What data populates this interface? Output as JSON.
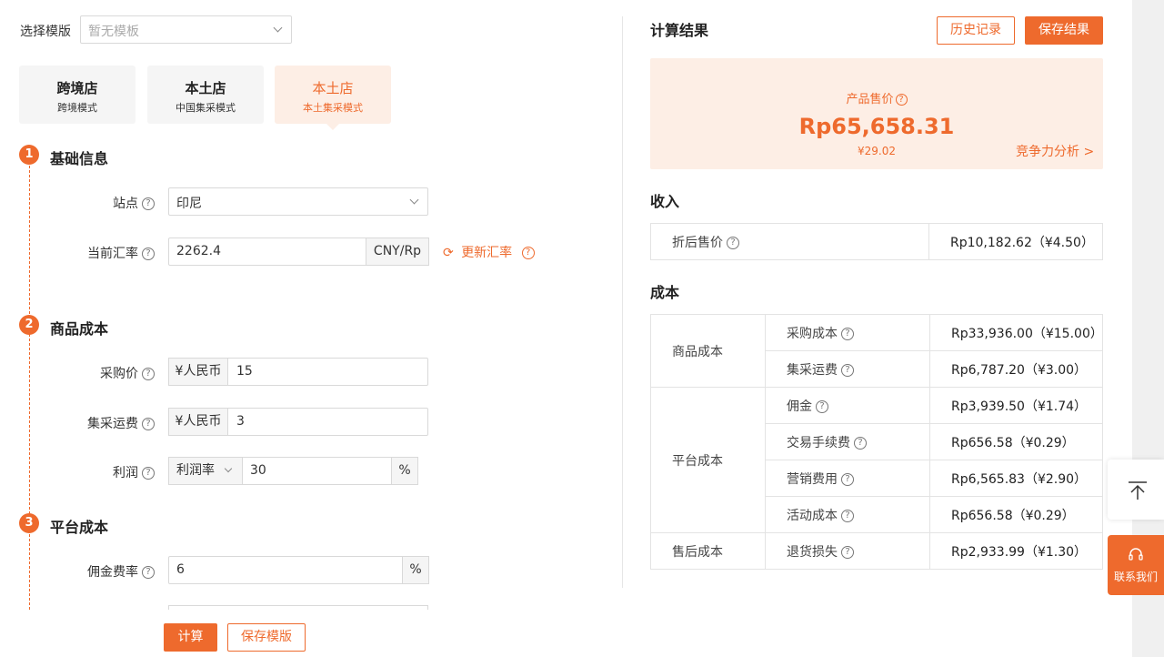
{
  "template": {
    "label": "选择模版",
    "placeholder": "暂无模板"
  },
  "store_cards": [
    {
      "title": "跨境店",
      "sub": "跨境模式"
    },
    {
      "title": "本土店",
      "sub": "中国集采模式"
    },
    {
      "title": "本土店",
      "sub": "本土集采模式"
    }
  ],
  "section1": {
    "num": "1",
    "title": "基础信息",
    "site_label": "站点",
    "site_value": "印尼",
    "rate_label": "当前汇率",
    "rate_value": "2262.4",
    "rate_unit": "CNY/Rp",
    "update_rate": "更新汇率"
  },
  "section2": {
    "num": "2",
    "title": "商品成本",
    "purchase_label": "采购价",
    "purchase_currency": "¥人民币",
    "purchase_value": "15",
    "freight_label": "集采运费",
    "freight_currency": "¥人民币",
    "freight_value": "3",
    "profit_label": "利润",
    "profit_type": "利润率",
    "profit_value": "30",
    "profit_unit": "%"
  },
  "section3": {
    "num": "3",
    "title": "平台成本",
    "commission_label": "佣金费率",
    "commission_value": "6",
    "commission_unit": "%"
  },
  "bottom_buttons": {
    "calc": "计算",
    "save_template": "保存模版"
  },
  "result": {
    "title": "计算结果",
    "history_btn": "历史记录",
    "save_btn": "保存结果",
    "price_label": "产品售价",
    "price_value": "Rp65,658.31",
    "price_cny": "¥29.02",
    "competition": "竞争力分析 >"
  },
  "income": {
    "title": "收入",
    "rows": [
      {
        "label": "折后售价",
        "value": "Rp10,182.62（¥4.50）"
      }
    ]
  },
  "cost": {
    "title": "成本",
    "groups": [
      {
        "name": "商品成本",
        "rows": [
          {
            "label": "采购成本",
            "value": "Rp33,936.00（¥15.00）"
          },
          {
            "label": "集采运费",
            "value": "Rp6,787.20（¥3.00）"
          }
        ]
      },
      {
        "name": "平台成本",
        "rows": [
          {
            "label": "佣金",
            "value": "Rp3,939.50（¥1.74）"
          },
          {
            "label": "交易手续费",
            "value": "Rp656.58（¥0.29）"
          },
          {
            "label": "营销费用",
            "value": "Rp6,565.83（¥2.90）"
          },
          {
            "label": "活动成本",
            "value": "Rp656.58（¥0.29）"
          }
        ]
      },
      {
        "name": "售后成本",
        "rows": [
          {
            "label": "退货损失",
            "value": "Rp2,933.99（¥1.30）"
          }
        ]
      }
    ]
  },
  "side": {
    "contact": "联系我们"
  },
  "colors": {
    "accent": "#ee6a2d",
    "accent_light": "#fdeee5"
  }
}
